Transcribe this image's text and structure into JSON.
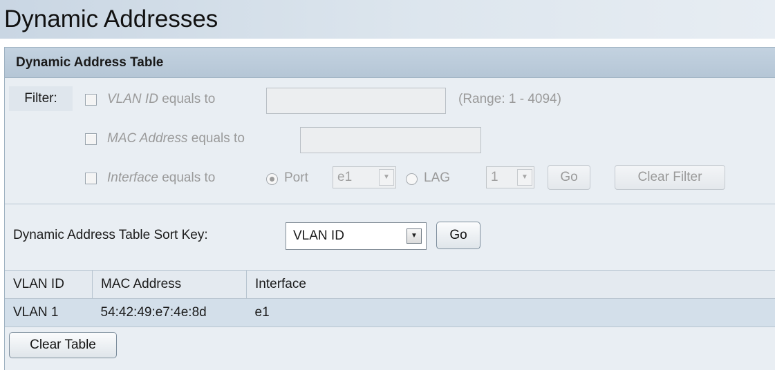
{
  "page_title": "Dynamic Addresses",
  "panel_title": "Dynamic Address Table",
  "filter": {
    "label": "Filter:",
    "vlan": {
      "field": "VLAN ID",
      "suffix": " equals to",
      "value": "",
      "range": "(Range: 1 - 4094)"
    },
    "mac": {
      "field": "MAC Address",
      "suffix": " equals to",
      "value": ""
    },
    "interface": {
      "field": "Interface",
      "suffix": " equals to",
      "port_label": "Port",
      "port_value": "e1",
      "lag_label": "LAG",
      "lag_value": "1",
      "go_label": "Go",
      "clear_label": "Clear Filter"
    }
  },
  "sort": {
    "label": "Dynamic Address Table Sort Key:",
    "value": "VLAN ID",
    "go_label": "Go"
  },
  "table": {
    "headers": [
      "VLAN ID",
      "MAC Address",
      "Interface"
    ],
    "rows": [
      [
        "VLAN 1",
        "54:42:49:e7:4e:8d",
        "e1"
      ]
    ]
  },
  "clear_table_label": "Clear Table",
  "icons": {
    "dropdown": "chevron-down-icon"
  }
}
